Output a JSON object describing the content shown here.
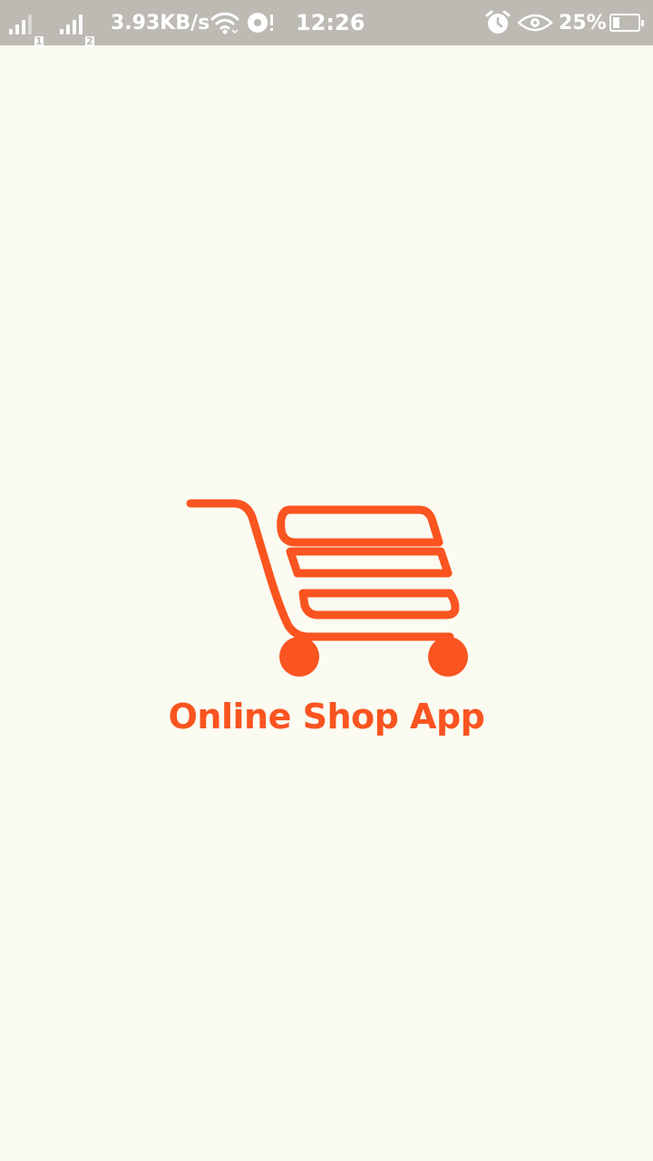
{
  "status_bar": {
    "sim1_label": "1",
    "sim2_label": "2",
    "network_speed": "3.93KB/s",
    "time": "12:26",
    "battery_percent": "25%",
    "battery_level": 0.25,
    "icons": [
      "signal-sim1-icon",
      "signal-sim2-icon",
      "wifi-icon",
      "sync-alert-icon",
      "alarm-icon",
      "eye-protection-icon",
      "battery-icon"
    ]
  },
  "splash": {
    "logo_icon": "shopping-cart-icon",
    "app_name": "Online Shop App",
    "brand_color": "#fa5420",
    "background_color": "#fbfbf1"
  }
}
